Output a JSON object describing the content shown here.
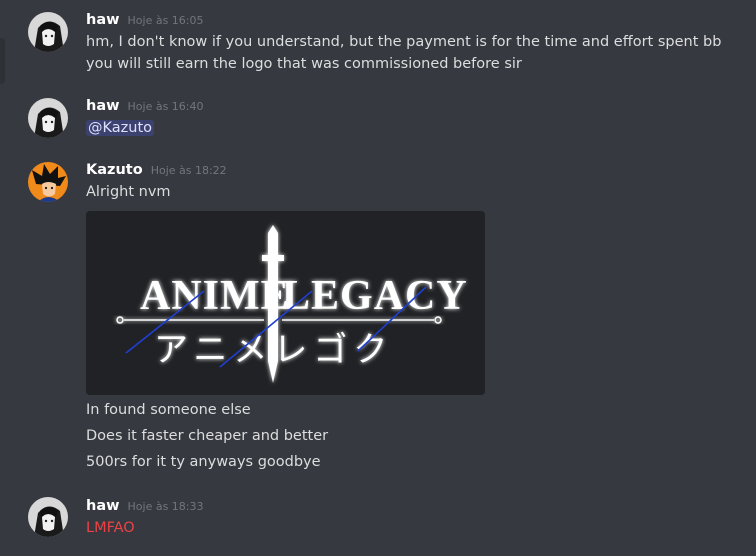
{
  "messages": [
    {
      "author": "haw",
      "time": "Hoje às 16:05",
      "lines": [
        "hm, I don't know if you understand, but the payment is for the time and effort spent bb",
        "you will still earn the logo that was commissioned before sir"
      ]
    },
    {
      "author": "haw",
      "time": "Hoje às 16:40",
      "mention": "@Kazuto"
    },
    {
      "author": "Kazuto",
      "time": "Hoje às 18:22",
      "line0": "Alright nvm",
      "image": {
        "logo_left": "ANIME",
        "logo_right": "LEGACY",
        "logo_jp": "アニメレゴク"
      },
      "after": [
        "In found someone else",
        "Does it faster cheaper and better",
        "500rs for it ty anyways goodbye"
      ]
    },
    {
      "author": "haw",
      "time": "Hoje às 18:33",
      "line0": "LMFAO"
    }
  ],
  "colors": {
    "background": "#36393f",
    "mention_bg": "#3c4270",
    "mention_text": "#dee0fc",
    "alert_red": "#ed4245"
  }
}
